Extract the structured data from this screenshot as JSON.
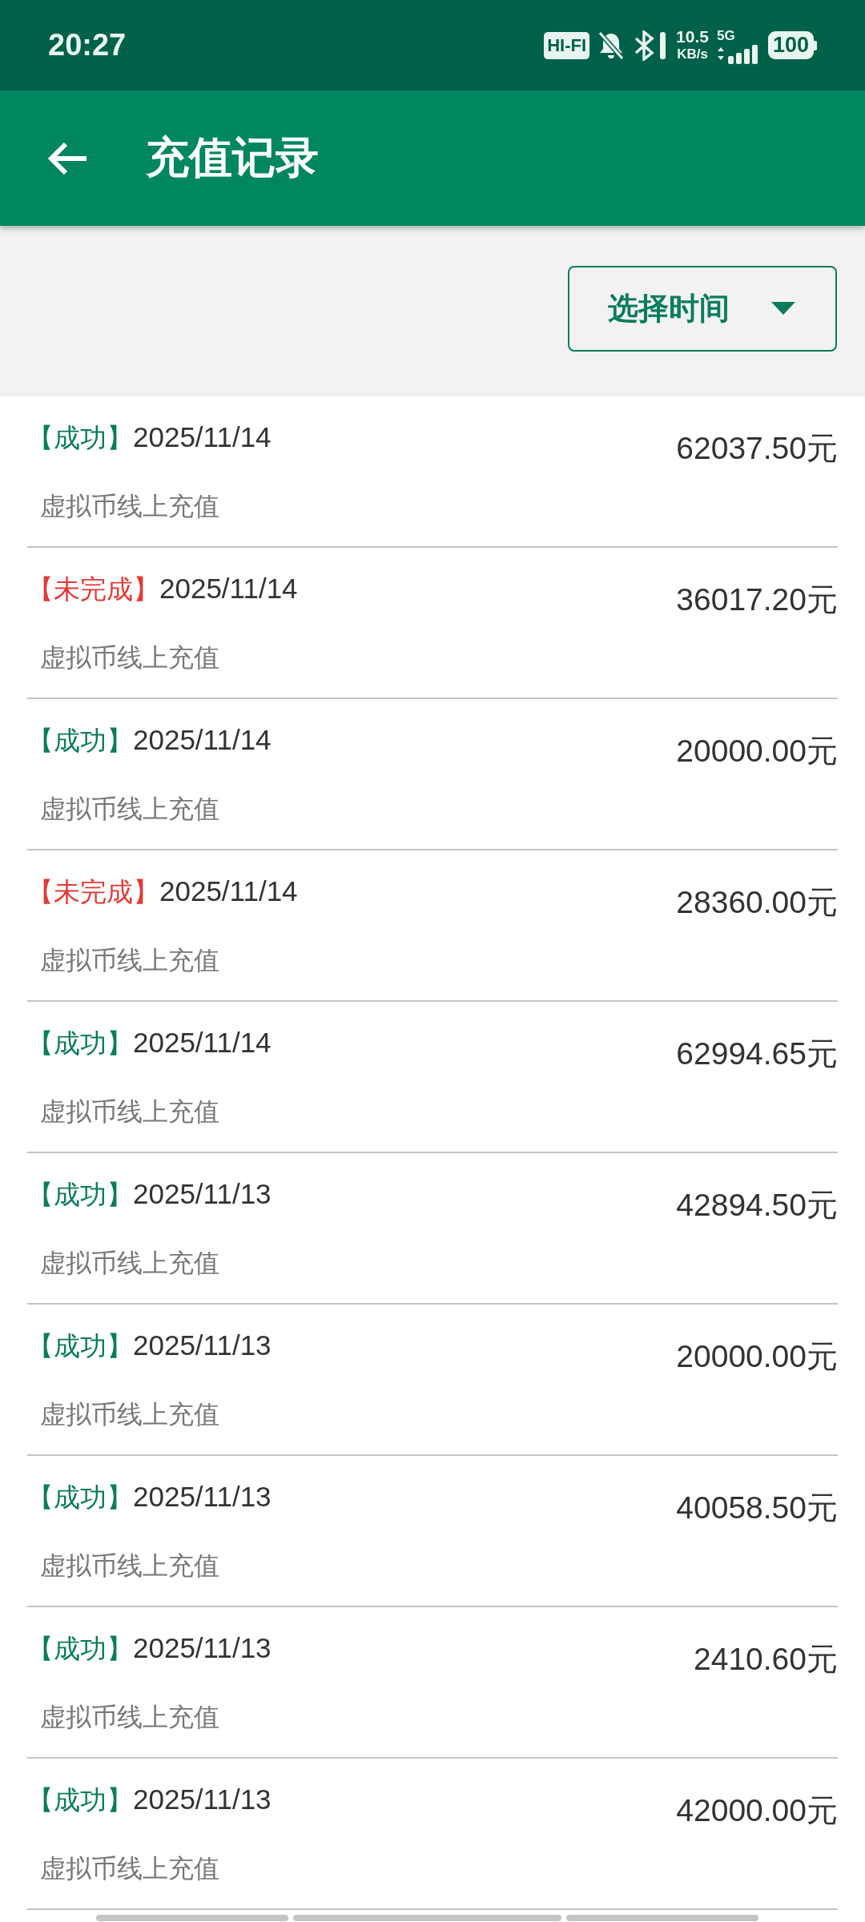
{
  "status_bar": {
    "time": "20:27",
    "hifi": "HI-FI",
    "speed": "10.5",
    "speed_unit": "KB/s",
    "network": "5G",
    "battery": "100"
  },
  "app_bar": {
    "title": "充值记录"
  },
  "filter": {
    "label": "选择时间"
  },
  "records": [
    {
      "status": "【成功】",
      "kind": "success",
      "date": "2025/11/14",
      "amount": "62037.50元",
      "description": "虚拟币线上充值"
    },
    {
      "status": "【未完成】",
      "kind": "pending",
      "date": "2025/11/14",
      "amount": "36017.20元",
      "description": "虚拟币线上充值"
    },
    {
      "status": "【成功】",
      "kind": "success",
      "date": "2025/11/14",
      "amount": "20000.00元",
      "description": "虚拟币线上充值"
    },
    {
      "status": "【未完成】",
      "kind": "pending",
      "date": "2025/11/14",
      "amount": "28360.00元",
      "description": "虚拟币线上充值"
    },
    {
      "status": "【成功】",
      "kind": "success",
      "date": "2025/11/14",
      "amount": "62994.65元",
      "description": "虚拟币线上充值"
    },
    {
      "status": "【成功】",
      "kind": "success",
      "date": "2025/11/13",
      "amount": "42894.50元",
      "description": "虚拟币线上充值"
    },
    {
      "status": "【成功】",
      "kind": "success",
      "date": "2025/11/13",
      "amount": "20000.00元",
      "description": "虚拟币线上充值"
    },
    {
      "status": "【成功】",
      "kind": "success",
      "date": "2025/11/13",
      "amount": "40058.50元",
      "description": "虚拟币线上充值"
    },
    {
      "status": "【成功】",
      "kind": "success",
      "date": "2025/11/13",
      "amount": "2410.60元",
      "description": "虚拟币线上充值"
    },
    {
      "status": "【成功】",
      "kind": "success",
      "date": "2025/11/13",
      "amount": "42000.00元",
      "description": "虚拟币线上充值"
    }
  ]
}
